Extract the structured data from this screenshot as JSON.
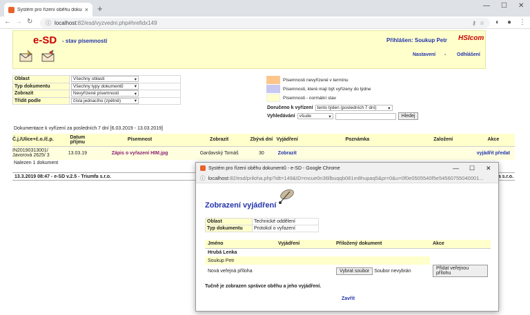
{
  "browser": {
    "tab_title": "Systém pro řízení oběhu dokum...",
    "url_host": "localhost",
    "url_rest": ":82/esd/vyzvedni.php#hrefidx149"
  },
  "header": {
    "logo": "e-SD",
    "title": "- stav písemností",
    "user": "Přihlášen: Soukup Petr",
    "brand": "HSIcom",
    "nav_settings": "Nastavení",
    "nav_sep": "-",
    "nav_logout": "Odhlášení"
  },
  "filters": [
    {
      "label": "Oblast",
      "value": "Všechny oblasti"
    },
    {
      "label": "Typ dokumentu",
      "value": "Všechny typy dokumentů"
    },
    {
      "label": "Zobrazit",
      "value": "Nevyřízené písemnosti"
    },
    {
      "label": "Třídit podle",
      "value": "čísla jednacího (zpětně)"
    }
  ],
  "legend": [
    {
      "text": "Písemnosti nevyřízené v termínu",
      "color": "#ffc68c"
    },
    {
      "text": "Písemnosti, které mají být vyřízeny do týdne",
      "color": "#c8c8f0"
    },
    {
      "text": "Písemnosti - normální stav",
      "color": "#ffffcc"
    }
  ],
  "received": {
    "label": "Doručeno k vyřízení",
    "value": "tento týden (posledních 7 dní)"
  },
  "search": {
    "label": "Vyhledávání",
    "scope": "všude",
    "button": "Hledej"
  },
  "doc_info": "Dokumentace k vyřízení za posledních 7 dní [6.03.2019 - 13.03.2019]",
  "doc_table": {
    "headers": [
      "Č.j./Ulice+č.o./č.p.",
      "Datum příjmu",
      "Písemnost",
      "Zobrazit",
      "Zbývá dní",
      "Vyjádření",
      "Poznámka",
      "Založení",
      "Akce"
    ],
    "row": {
      "cj": "IN20190313001/ Javorová 2625/ 3",
      "date": "13.03.19",
      "doc": "Zápis o vyřazení HIM.jpg",
      "person": "Gardavský Tomáš",
      "days": "30",
      "show": "Zobrazit",
      "act1": "vyjádřit",
      "act2": "předat"
    }
  },
  "found": "Nalezen 1 dokument",
  "footer": "13.3.2019 08:47 - e-SD v.2.5 - Triumfa s.r.o.",
  "footer_right": "ra s.r.o.",
  "popup": {
    "title": "Systém pro řízení oběhu dokumentů - e-SD - Google Chrome",
    "url_host": "localhost",
    "url_rest": ":82/esd/priloha.php?idt=149&ID=mcue0n36llbuqqb081m8hupaq5&pr=0&u=0f0e0505540f5e54560755040001...",
    "heading": "Zobrazení vyjádření",
    "info": [
      {
        "label": "Oblast",
        "value": "Technické oddělení"
      },
      {
        "label": "Typ dokumentu",
        "value": "Protokol o vyřazení"
      }
    ],
    "headers": [
      "Jméno",
      "Vyjádření",
      "Přiložený dokument",
      "Akce"
    ],
    "rows": [
      "Hrubá Lenka",
      "Soukup Petr"
    ],
    "attach_label": "Nová veřejná příloha",
    "choose_btn": "Vybrat soubor",
    "no_file": "Soubor nevybrán",
    "add_btn": "Přidat veřejnou přílohu",
    "note": "Tučně je zobrazen správce oběhu a jeho vyjádření.",
    "close": "Zavřít"
  }
}
